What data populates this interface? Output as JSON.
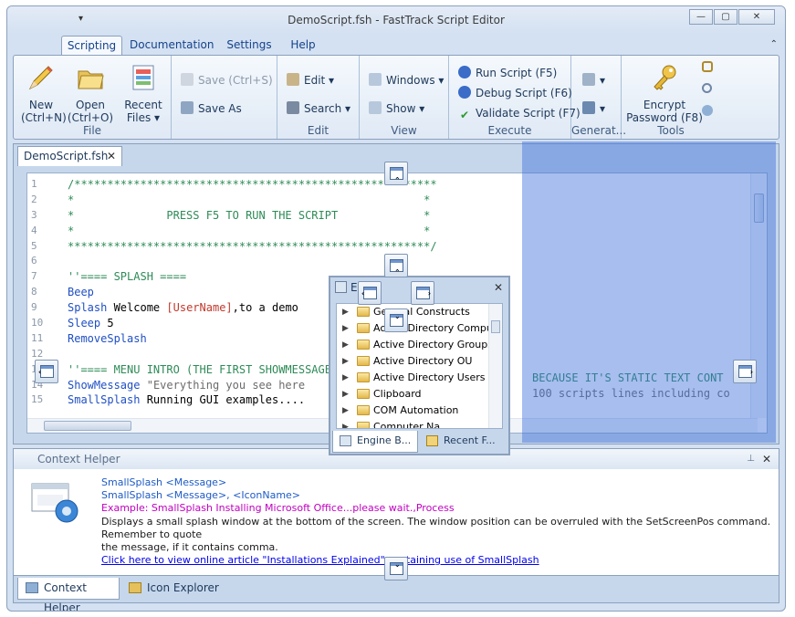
{
  "window": {
    "title": "DemoScript.fsh - FastTrack Script Editor",
    "qat_symbol": "▾",
    "min": "—",
    "max": "▢",
    "close": "✕"
  },
  "tabs": [
    "Scripting",
    "Documentation",
    "Settings",
    "Help"
  ],
  "ribbon": {
    "file": {
      "label": "File",
      "new": "New",
      "new_key": "(Ctrl+N)",
      "open": "Open",
      "open_key": "(Ctrl+O)",
      "recent": "Recent",
      "recent2": "Files ▾"
    },
    "save": {
      "save": "Save (Ctrl+S)",
      "save_as": "Save As"
    },
    "edit": {
      "label": "Edit",
      "edit": "Edit ▾",
      "search": "Search ▾"
    },
    "view": {
      "label": "View",
      "windows": "Windows ▾",
      "show": "Show ▾"
    },
    "execute": {
      "label": "Execute",
      "run": "Run Script (F5)",
      "debug": "Debug Script (F6)",
      "validate": "Validate Script (F7)"
    },
    "generate": {
      "label": "Generat..."
    },
    "tools": {
      "label": "Tools",
      "encrypt": "Encrypt",
      "encrypt2": "Password (F8)"
    }
  },
  "document_tab": {
    "label": "DemoScript.fsh",
    "close": "✕"
  },
  "editor": {
    "lines": [
      {
        "n": "1",
        "text": "/*******************************************************",
        "color": "#2e8b57"
      },
      {
        "n": "2",
        "text": "*                                                     *",
        "color": "#2e8b57"
      },
      {
        "n": "3",
        "text": "*              PRESS F5 TO RUN THE SCRIPT             *",
        "color": "#2e8b57"
      },
      {
        "n": "4",
        "text": "*                                                     *",
        "color": "#2e8b57"
      },
      {
        "n": "5",
        "text": "*******************************************************/",
        "color": "#2e8b57"
      },
      {
        "n": "6",
        "text": "",
        "color": "#000"
      },
      {
        "n": "7",
        "text": "''==== SPLASH ====",
        "color": "#2e8b57"
      },
      {
        "n": "8",
        "text": "Beep",
        "color": "#1f4fc4"
      },
      {
        "n": "9",
        "text": "Splash Welcome [UserName],to a demo",
        "color": "#000"
      },
      {
        "n": "10",
        "text": "Sleep 5",
        "color": "#000"
      },
      {
        "n": "11",
        "text": "RemoveSplash",
        "color": "#1f4fc4"
      },
      {
        "n": "12",
        "text": "",
        "color": "#000"
      },
      {
        "n": "13",
        "text": "''==== MENU INTRO (THE FIRST SHOWMESSAGE",
        "color": "#2e8b57"
      },
      {
        "n": "14",
        "text": "ShowMessage \"Everything you see here",
        "color": "#000"
      },
      {
        "n": "15",
        "text": "SmallSplash Running GUI examples....",
        "color": "#000"
      }
    ],
    "right_text_1": "BECAUSE IT'S STATIC TEXT CONT",
    "right_text_2": "100 scripts lines including co"
  },
  "float_panel": {
    "title": "E",
    "close": "✕",
    "items": [
      "General Constructs",
      "Active Directory Compu...",
      "Active Directory Groups",
      "Active Directory OU",
      "Active Directory Users",
      "Clipboard",
      "COM Automation",
      "Computer Na..."
    ],
    "tab1": "Engine B...",
    "tab2": "Recent F..."
  },
  "helper": {
    "title": "Context Helper",
    "pin": "📌",
    "close": "✕",
    "sig1": "SmallSplash <Message>",
    "sig2": "SmallSplash <Message>, <IconName>",
    "example": "Example: SmallSplash Installing Microsoft Office...please wait.,Process",
    "desc1": "Displays a small splash window at the bottom of the screen. The window position can be overruled with the SetScreenPos command. Remember to quote",
    "desc2": "the message, if it contains comma.",
    "link": "Click here to view online article \"Installations Explained\" containing use of SmallSplash",
    "tab1": "Context Helper",
    "tab2": "Icon Explorer"
  },
  "colors": {
    "accent": "#15428b",
    "example": "#c000c0",
    "link": "#0000ee",
    "overlay": "#3c6edc"
  }
}
